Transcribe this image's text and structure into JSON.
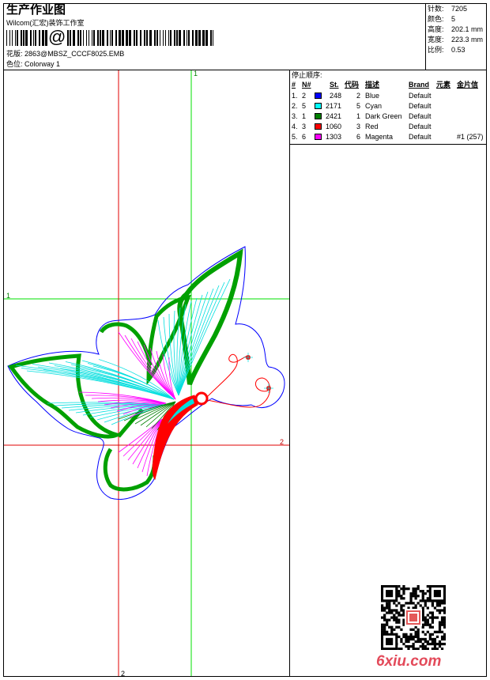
{
  "header": {
    "title": "生产作业图",
    "studio": "Wilcom(汇宏)装饰工作室",
    "barcode_text": "@",
    "design_label": "花版:",
    "design_value": "2863@MBSZ_CCCF8025.EMB",
    "colorway_label": "色位:",
    "colorway_value": "Colorway 1"
  },
  "stats": [
    {
      "label": "针数:",
      "value": "7205"
    },
    {
      "label": "颜色:",
      "value": "5"
    },
    {
      "label": "高度:",
      "value": "202.1 mm"
    },
    {
      "label": "宽度:",
      "value": "223.3 mm"
    },
    {
      "label": "比例:",
      "value": "0.53"
    }
  ],
  "stop_sequence": {
    "title": "停止顺序:",
    "headers": {
      "num": "#",
      "n": "N#",
      "st": "St.",
      "code": "代码",
      "desc": "描述",
      "brand": "Brand",
      "element": "元素",
      "sequin": "金片信"
    },
    "rows": [
      {
        "num": "1.",
        "n": "2",
        "st": "248",
        "code": "2",
        "desc": "Blue",
        "brand": "Default",
        "extra": "",
        "color": "#0000ff"
      },
      {
        "num": "2.",
        "n": "5",
        "st": "2171",
        "code": "5",
        "desc": "Cyan",
        "brand": "Default",
        "extra": "",
        "color": "#00ffff"
      },
      {
        "num": "3.",
        "n": "1",
        "st": "2421",
        "code": "1",
        "desc": "Dark Green",
        "brand": "Default",
        "extra": "",
        "color": "#008000"
      },
      {
        "num": "4.",
        "n": "3",
        "st": "1060",
        "code": "3",
        "desc": "Red",
        "brand": "Default",
        "extra": "",
        "color": "#ff0000"
      },
      {
        "num": "5.",
        "n": "6",
        "st": "1303",
        "code": "6",
        "desc": "Magenta",
        "brand": "Default",
        "extra": "#1 (257)",
        "color": "#ff00ff"
      }
    ]
  },
  "guides": {
    "v1": "1",
    "h1": "1",
    "v2": "2",
    "h2": "2",
    "green": "#00e000",
    "red": "#e00000"
  },
  "watermark": {
    "text": "6xiu.com",
    "color": "#e34a5a"
  }
}
